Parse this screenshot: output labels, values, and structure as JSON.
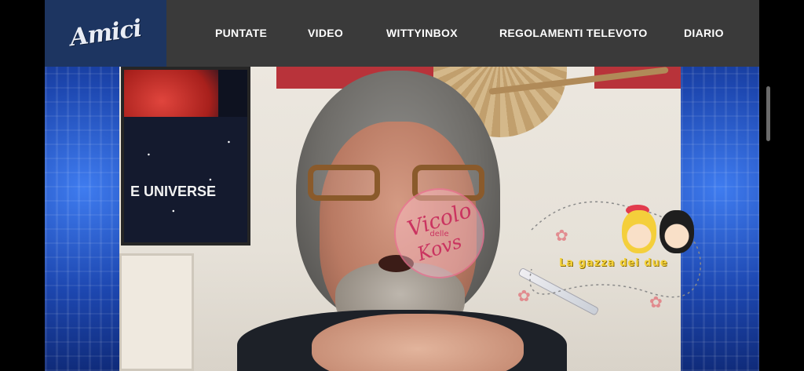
{
  "logo": {
    "text": "Amici",
    "brand_bg": "#1d3561"
  },
  "header": {
    "bg": "#3a3a3a",
    "nav": [
      {
        "label": "PUNTATE"
      },
      {
        "label": "VIDEO"
      },
      {
        "label": "WITTYINBOX"
      },
      {
        "label": "REGOLAMENTI TELEVOTO"
      },
      {
        "label": "DIARIO"
      }
    ]
  },
  "video": {
    "poster_text": "E UNIVERSE",
    "watermark": {
      "line1": "Vicolo",
      "line2": "delle",
      "line3": "Kovs"
    },
    "sticker_text": "La gazza dei due"
  }
}
